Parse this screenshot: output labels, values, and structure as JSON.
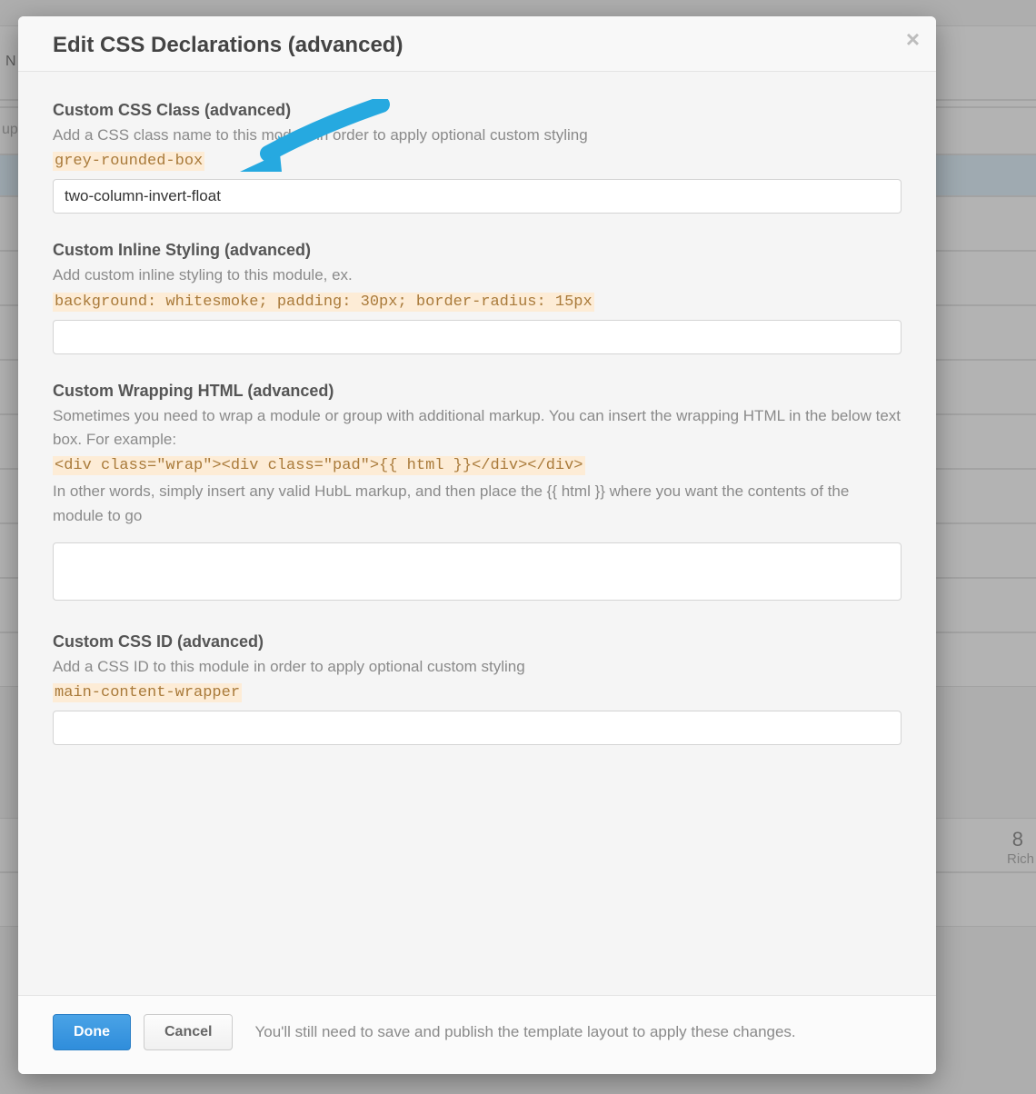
{
  "background": {
    "partial_left_text_1": "N",
    "partial_left_text_2": "up",
    "right_number": "8",
    "right_word": "Rich"
  },
  "modal": {
    "title": "Edit CSS Declarations (advanced)",
    "sections": {
      "css_class": {
        "title": "Custom CSS Class (advanced)",
        "desc": "Add a CSS class name to this module in order to apply optional custom styling",
        "example": "grey-rounded-box",
        "value": "two-column-invert-float"
      },
      "inline_style": {
        "title": "Custom Inline Styling (advanced)",
        "desc": "Add custom inline styling to this module, ex.",
        "example": "background: whitesmoke; padding: 30px; border-radius: 15px",
        "value": ""
      },
      "wrap_html": {
        "title": "Custom Wrapping HTML (advanced)",
        "desc": "Sometimes you need to wrap a module or group with additional markup. You can insert the wrapping HTML in the below text box. For example:",
        "example": "<div class=\"wrap\"><div class=\"pad\">{{ html }}</div></div>",
        "desc2": "In other words, simply insert any valid HubL markup, and then place the {{ html }} where you want the contents of the module to go",
        "value": ""
      },
      "css_id": {
        "title": "Custom CSS ID (advanced)",
        "desc": "Add a CSS ID to this module in order to apply optional custom styling",
        "example": "main-content-wrapper",
        "value": ""
      }
    },
    "footer": {
      "done": "Done",
      "cancel": "Cancel",
      "note": "You'll still need to save and publish the template layout to apply these changes."
    }
  },
  "annotation": {
    "arrow_color": "#26a9e0"
  }
}
